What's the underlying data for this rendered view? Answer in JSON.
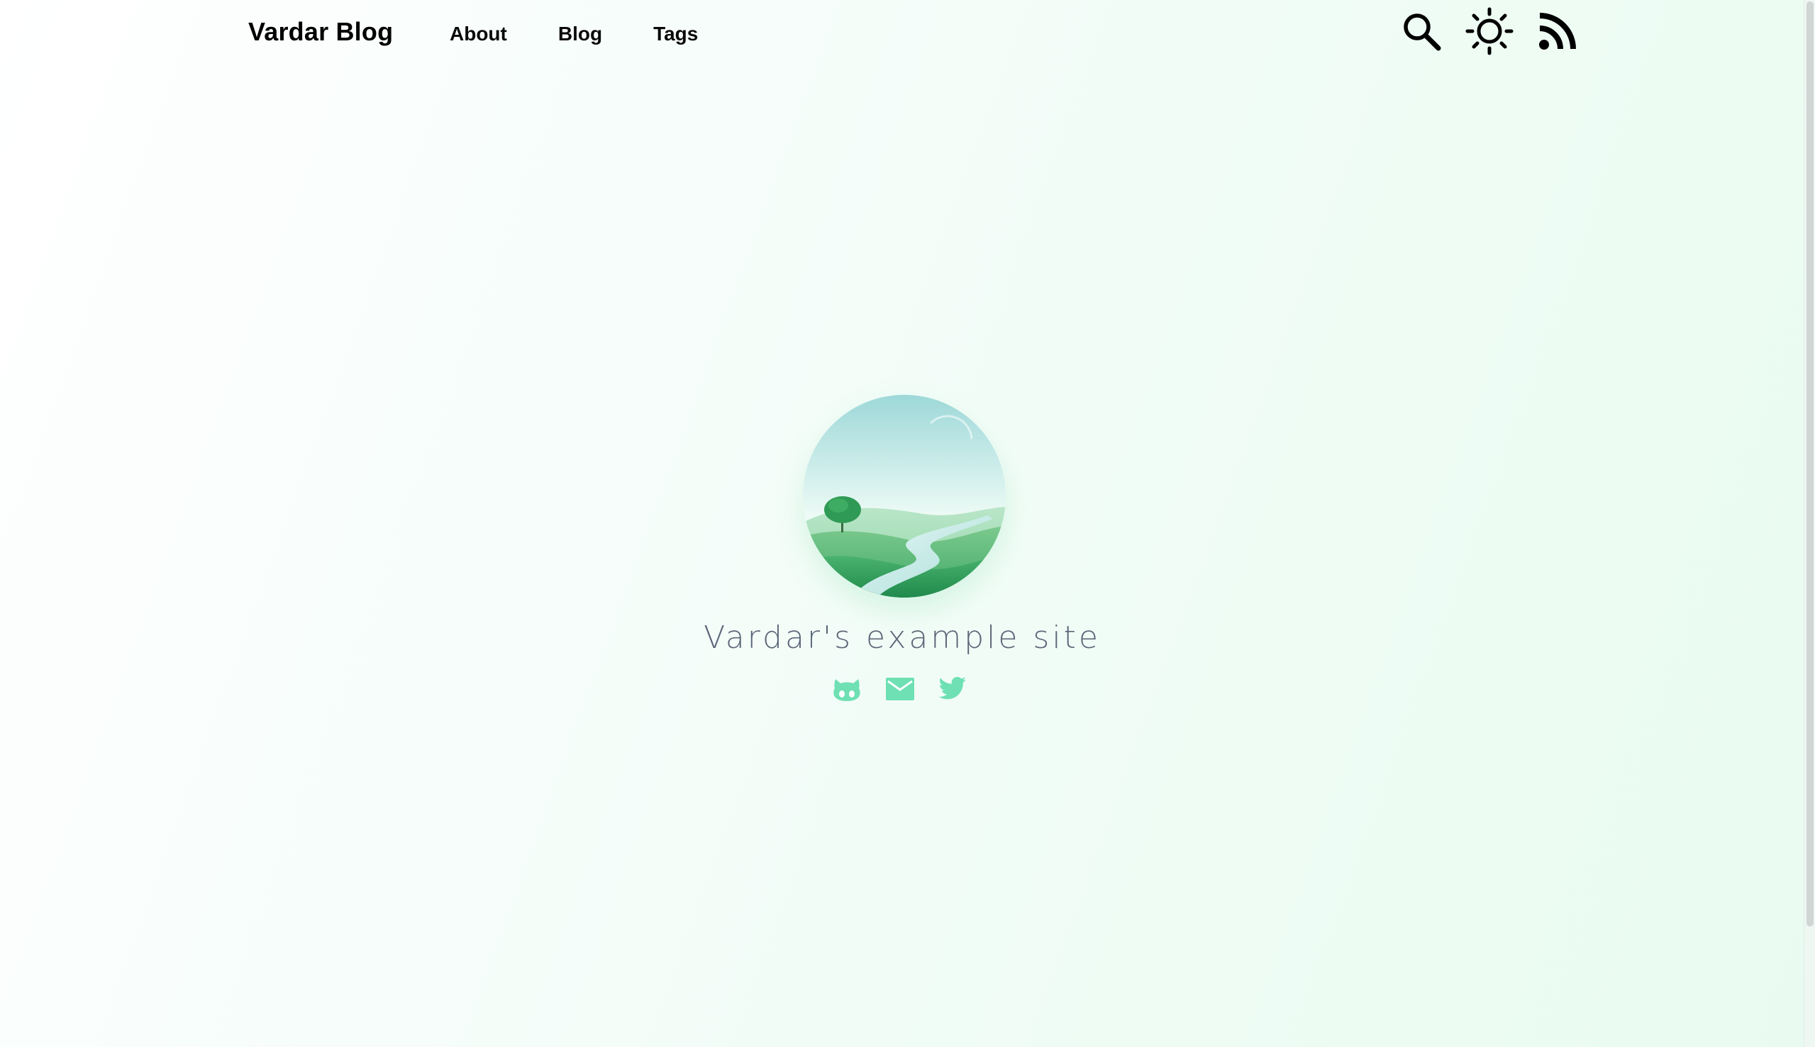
{
  "header": {
    "site_title": "Vardar Blog",
    "nav": [
      {
        "label": "About"
      },
      {
        "label": "Blog"
      },
      {
        "label": "Tags"
      }
    ],
    "actions": [
      {
        "icon": "search-icon"
      },
      {
        "icon": "sun-icon"
      },
      {
        "icon": "rss-icon"
      }
    ]
  },
  "main": {
    "subtitle": "Vardar's example site",
    "social_links": [
      {
        "icon": "github-icon"
      },
      {
        "icon": "email-icon"
      },
      {
        "icon": "twitter-icon"
      }
    ]
  },
  "colors": {
    "accent": "#6ee0b4",
    "subtitle_text": "#5b6678",
    "nav_text": "#0a0a0a"
  }
}
